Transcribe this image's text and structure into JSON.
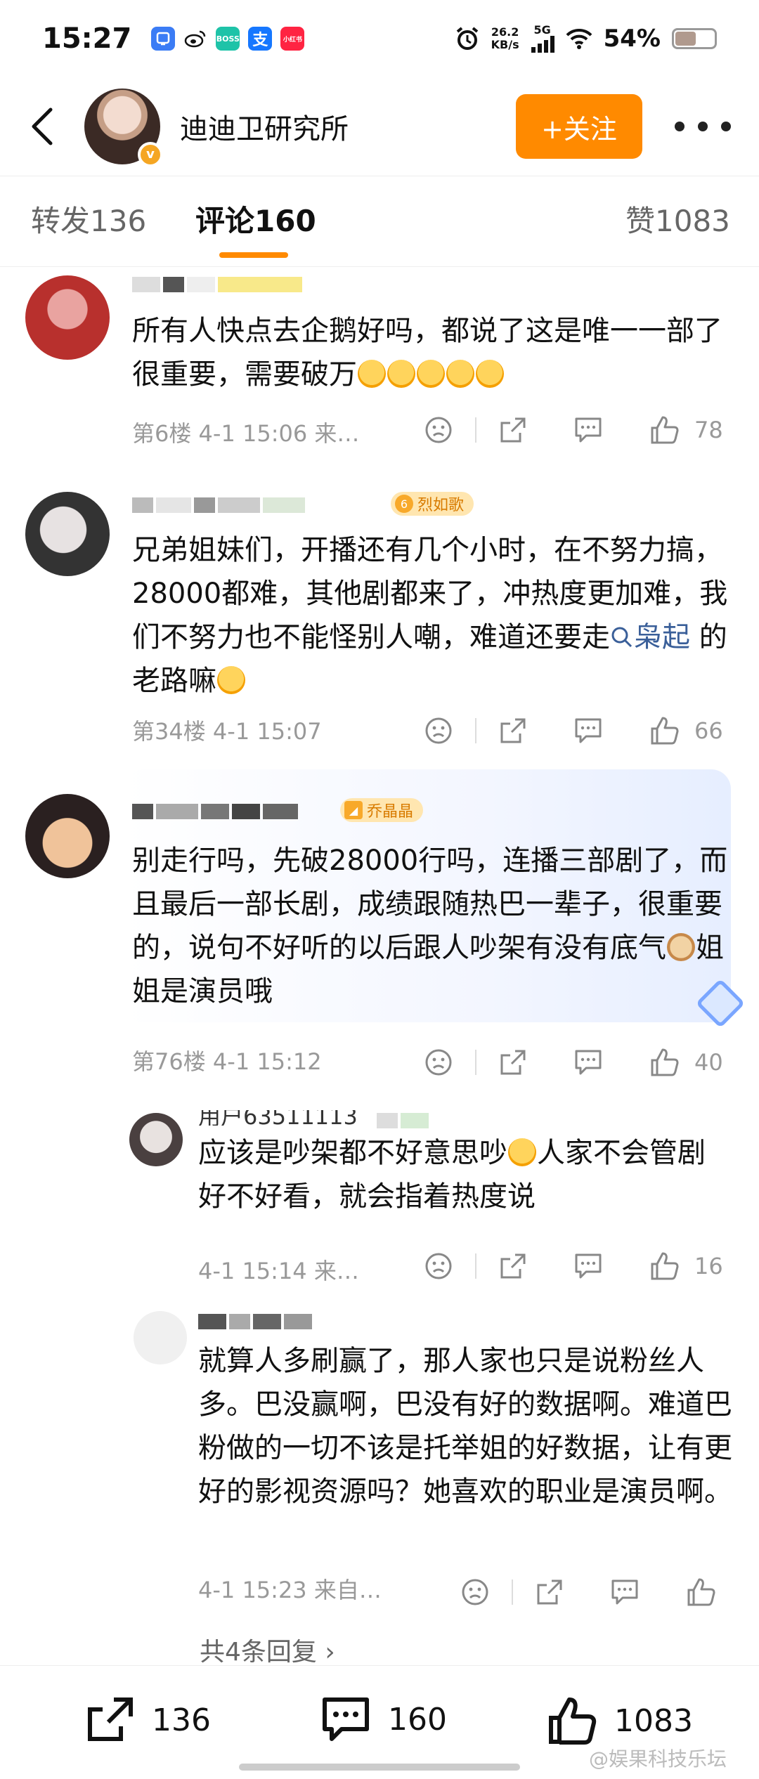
{
  "status_bar": {
    "time": "15:27",
    "app_icons": [
      {
        "name": "app-icon-blue",
        "label": "",
        "color": "#3b7cf5"
      },
      {
        "name": "weibo-icon",
        "label": "",
        "color": "#e6162d"
      },
      {
        "name": "boss-icon",
        "label": "BOSS",
        "color": "#1ec3a8"
      },
      {
        "name": "alipay-icon",
        "label": "支",
        "color": "#1677ff"
      },
      {
        "name": "xiaohongshu-icon",
        "label": "小红书",
        "color": "#ff2442"
      }
    ],
    "net_speed_value": "26.2",
    "net_speed_unit": "KB/s",
    "network": "5G",
    "battery": "54%",
    "battery_level": 0.54
  },
  "header": {
    "title": "迪迪卫研究所",
    "follow_label": "+关注"
  },
  "tabs": [
    {
      "label": "转发",
      "count": "136"
    },
    {
      "label": "评论",
      "count": "160",
      "active": true
    },
    {
      "label": "赞",
      "count": "1083"
    }
  ],
  "comments": [
    {
      "text": "所有人快点去企鹅好吗，都说了这是唯一一部了很重要，需要破万",
      "emoji_count": 5,
      "floor": "第6楼",
      "time": "4-1 15:06",
      "source": "来…",
      "likes": "78"
    },
    {
      "fan_badge_level": "6",
      "fan_badge": "烈如歌",
      "text_before": "兄弟姐妹们，开播还有几个小时，在不努力搞，28000都难，其他剧都来了，冲热度更加难，我们不努力也不能怪别人嘲，难道还要走",
      "topic": "枭起",
      "text_after": "的老路嘛",
      "floor": "第34楼",
      "time": "4-1 15:07",
      "likes": "66"
    },
    {
      "fan_badge": "乔晶晶",
      "text": "别走行吗，先破28000行吗，连播三部剧了，而且最后一部长剧，成绩跟随热巴一辈子，很重要的，说句不好听的以后跟人吵架有没有底气",
      "text_after": "姐姐是演员哦",
      "floor": "第76楼",
      "time": "4-1 15:12",
      "likes": "40"
    }
  ],
  "replies": [
    {
      "username_partial": "用户63511113",
      "text_before": "应该是吵架都不好意思吵",
      "text_after": "人家不会管剧好不好看，就会指着热度说",
      "time": "4-1 15:14",
      "source": "来…",
      "likes": "16"
    },
    {
      "text": "就算人多刷赢了，那人家也只是说粉丝人多。巴没赢啊，巴没有好的数据啊。难道巴粉做的一切不该是托举姐的好数据，让有更好的影视资源吗？她喜欢的职业是演员啊。",
      "time": "4-1 15:23",
      "source": "来自…"
    }
  ],
  "more_replies": "共4条回复",
  "bottom_bar": {
    "repost": "136",
    "comment": "160",
    "like": "1083"
  },
  "watermark": "@娱果科技乐坛",
  "colors": {
    "accent": "#ff8a00",
    "link": "#3a5f99",
    "meta_text": "#999999"
  }
}
